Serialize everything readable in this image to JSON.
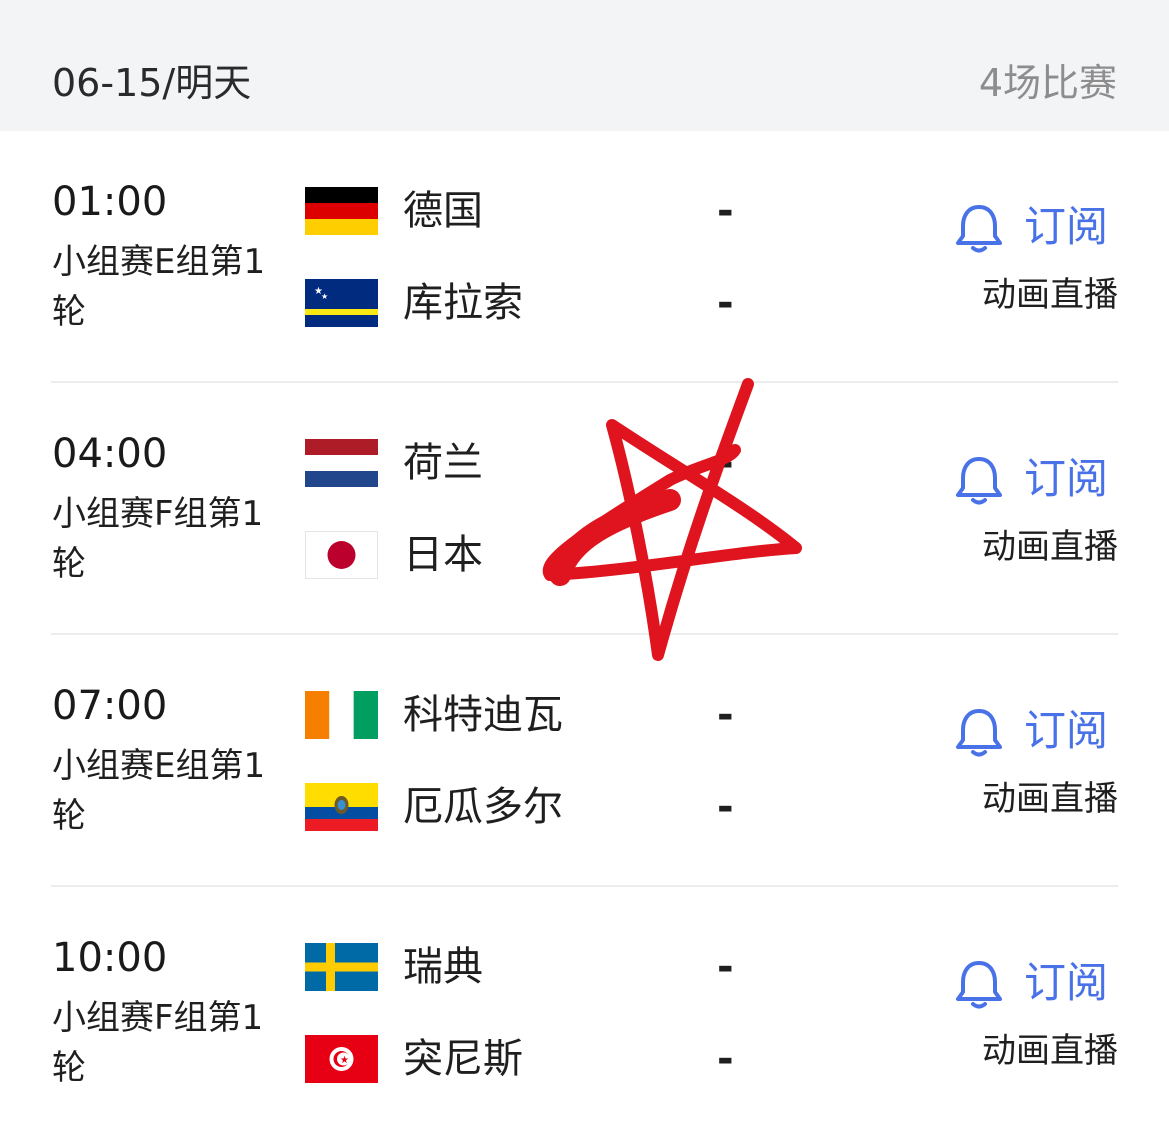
{
  "header": {
    "date": "06-15/明天",
    "match_count": "4场比赛"
  },
  "matches": [
    {
      "time": "01:00",
      "stage": "小组赛E组第1轮",
      "home": {
        "name": "德国",
        "score": "-",
        "flag": "germany-flag"
      },
      "away": {
        "name": "库拉索",
        "score": "-",
        "flag": "curacao-flag"
      },
      "subscribe_label": "订阅",
      "live_label": "动画直播"
    },
    {
      "time": "04:00",
      "stage": "小组赛F组第1轮",
      "home": {
        "name": "荷兰",
        "score": "-",
        "flag": "netherlands-flag"
      },
      "away": {
        "name": "日本",
        "score": "-",
        "flag": "japan-flag"
      },
      "subscribe_label": "订阅",
      "live_label": "动画直播"
    },
    {
      "time": "07:00",
      "stage": "小组赛E组第1轮",
      "home": {
        "name": "科特迪瓦",
        "score": "-",
        "flag": "ivory-coast-flag"
      },
      "away": {
        "name": "厄瓜多尔",
        "score": "-",
        "flag": "ecuador-flag"
      },
      "subscribe_label": "订阅",
      "live_label": "动画直播"
    },
    {
      "time": "10:00",
      "stage": "小组赛F组第1轮",
      "home": {
        "name": "瑞典",
        "score": "-",
        "flag": "sweden-flag"
      },
      "away": {
        "name": "突尼斯",
        "score": "-",
        "flag": "tunisia-flag"
      },
      "subscribe_label": "订阅",
      "live_label": "动画直播"
    }
  ],
  "colors": {
    "accent": "#4a72e8",
    "header_bg": "#f3f4f6",
    "divider": "#ececec",
    "annotation": "#e0141e"
  },
  "icons": {
    "subscribe": "bell-icon",
    "annotation": "red-star-scribble"
  }
}
